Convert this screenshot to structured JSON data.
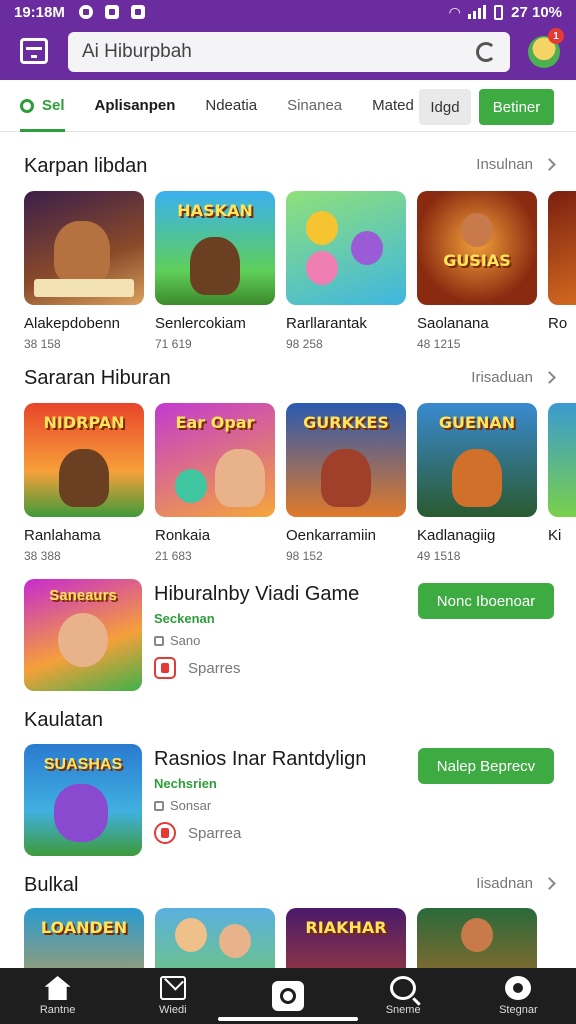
{
  "status_bar": {
    "time": "19:18M",
    "right_text": "27 10%"
  },
  "header": {
    "search_placeholder": "Ai Hiburpbah",
    "notification_count": "1"
  },
  "tabs": {
    "items": [
      "Sel",
      "Aplisanpen",
      "Ndeatia",
      "Sinanea",
      "Mated"
    ],
    "gray_button": "Idgd",
    "green_button": "Betiner"
  },
  "sections": [
    {
      "title": "Karpan libdan",
      "see_more": "Insulnan",
      "cards": [
        {
          "name": "Alakepdobenn",
          "meta": "38 158",
          "logo": ""
        },
        {
          "name": "Senlercokiam",
          "meta": "71 619",
          "logo": "HASKAN"
        },
        {
          "name": "Rarllarantak",
          "meta": "98 258",
          "logo": ""
        },
        {
          "name": "Saolanana",
          "meta": "48 1215",
          "logo": "GUSIAS"
        },
        {
          "name": "Ro",
          "meta": "",
          "logo": ""
        }
      ]
    },
    {
      "title": "Sararan Hiburan",
      "see_more": "Irisaduan",
      "cards": [
        {
          "name": "Ranlahama",
          "meta": "38 388",
          "logo": "NIDRPAN"
        },
        {
          "name": "Ronkaia",
          "meta": "21 683",
          "logo": "Ear Opar"
        },
        {
          "name": "Oenkarramiin",
          "meta": "98 152",
          "logo": "GURKKES"
        },
        {
          "name": "Kadlanagiig",
          "meta": "49 1518",
          "logo": "GUENAN"
        },
        {
          "name": "Ki",
          "meta": "",
          "logo": ""
        }
      ]
    }
  ],
  "features": [
    {
      "title": "Hiburalnby Viadi Game",
      "subtitle": "Seckenan",
      "line": "Sano",
      "share": "Sparres",
      "button": "Nonc Iboenoar",
      "logo": "Saneaurs"
    },
    {
      "section_title": "Kaulatan",
      "title": "Rasnios Inar Rantdylign",
      "subtitle": "Nechsrien",
      "line": "Sonsar",
      "share": "Sparrea",
      "button": "Nalep Beprecv",
      "logo": "SUASHAS"
    }
  ],
  "bottom_section": {
    "title": "Bulkal",
    "see_more": "Iisadnan",
    "logos": [
      "LOANDEN",
      "",
      "RIAKHAR",
      ""
    ]
  },
  "bottom_nav": [
    "Rantne",
    "Wiedi",
    "",
    "Sneme",
    "Stegnar"
  ]
}
